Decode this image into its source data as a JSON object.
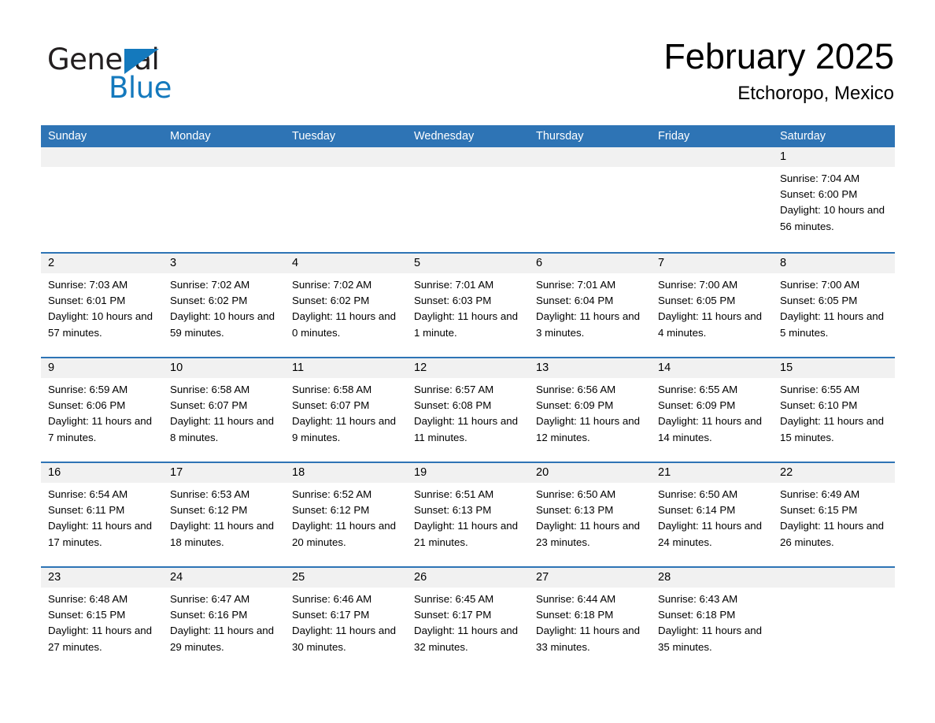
{
  "brand": {
    "name_part1": "General",
    "name_part2": "Blue"
  },
  "header": {
    "month_title": "February 2025",
    "location": "Etchoropo, Mexico"
  },
  "colors": {
    "header_blue": "#2e74b5",
    "logo_blue": "#1479bd",
    "day_band_gray": "#f1f1f1",
    "text": "#000000"
  },
  "weekdays": [
    "Sunday",
    "Monday",
    "Tuesday",
    "Wednesday",
    "Thursday",
    "Friday",
    "Saturday"
  ],
  "weeks": [
    [
      {
        "day": "",
        "sunrise": "",
        "sunset": "",
        "daylight": "",
        "empty": true
      },
      {
        "day": "",
        "sunrise": "",
        "sunset": "",
        "daylight": "",
        "empty": true
      },
      {
        "day": "",
        "sunrise": "",
        "sunset": "",
        "daylight": "",
        "empty": true
      },
      {
        "day": "",
        "sunrise": "",
        "sunset": "",
        "daylight": "",
        "empty": true
      },
      {
        "day": "",
        "sunrise": "",
        "sunset": "",
        "daylight": "",
        "empty": true
      },
      {
        "day": "",
        "sunrise": "",
        "sunset": "",
        "daylight": "",
        "empty": true
      },
      {
        "day": "1",
        "sunrise": "Sunrise: 7:04 AM",
        "sunset": "Sunset: 6:00 PM",
        "daylight": "Daylight: 10 hours and 56 minutes.",
        "empty": false
      }
    ],
    [
      {
        "day": "2",
        "sunrise": "Sunrise: 7:03 AM",
        "sunset": "Sunset: 6:01 PM",
        "daylight": "Daylight: 10 hours and 57 minutes.",
        "empty": false
      },
      {
        "day": "3",
        "sunrise": "Sunrise: 7:02 AM",
        "sunset": "Sunset: 6:02 PM",
        "daylight": "Daylight: 10 hours and 59 minutes.",
        "empty": false
      },
      {
        "day": "4",
        "sunrise": "Sunrise: 7:02 AM",
        "sunset": "Sunset: 6:02 PM",
        "daylight": "Daylight: 11 hours and 0 minutes.",
        "empty": false
      },
      {
        "day": "5",
        "sunrise": "Sunrise: 7:01 AM",
        "sunset": "Sunset: 6:03 PM",
        "daylight": "Daylight: 11 hours and 1 minute.",
        "empty": false
      },
      {
        "day": "6",
        "sunrise": "Sunrise: 7:01 AM",
        "sunset": "Sunset: 6:04 PM",
        "daylight": "Daylight: 11 hours and 3 minutes.",
        "empty": false
      },
      {
        "day": "7",
        "sunrise": "Sunrise: 7:00 AM",
        "sunset": "Sunset: 6:05 PM",
        "daylight": "Daylight: 11 hours and 4 minutes.",
        "empty": false
      },
      {
        "day": "8",
        "sunrise": "Sunrise: 7:00 AM",
        "sunset": "Sunset: 6:05 PM",
        "daylight": "Daylight: 11 hours and 5 minutes.",
        "empty": false
      }
    ],
    [
      {
        "day": "9",
        "sunrise": "Sunrise: 6:59 AM",
        "sunset": "Sunset: 6:06 PM",
        "daylight": "Daylight: 11 hours and 7 minutes.",
        "empty": false
      },
      {
        "day": "10",
        "sunrise": "Sunrise: 6:58 AM",
        "sunset": "Sunset: 6:07 PM",
        "daylight": "Daylight: 11 hours and 8 minutes.",
        "empty": false
      },
      {
        "day": "11",
        "sunrise": "Sunrise: 6:58 AM",
        "sunset": "Sunset: 6:07 PM",
        "daylight": "Daylight: 11 hours and 9 minutes.",
        "empty": false
      },
      {
        "day": "12",
        "sunrise": "Sunrise: 6:57 AM",
        "sunset": "Sunset: 6:08 PM",
        "daylight": "Daylight: 11 hours and 11 minutes.",
        "empty": false
      },
      {
        "day": "13",
        "sunrise": "Sunrise: 6:56 AM",
        "sunset": "Sunset: 6:09 PM",
        "daylight": "Daylight: 11 hours and 12 minutes.",
        "empty": false
      },
      {
        "day": "14",
        "sunrise": "Sunrise: 6:55 AM",
        "sunset": "Sunset: 6:09 PM",
        "daylight": "Daylight: 11 hours and 14 minutes.",
        "empty": false
      },
      {
        "day": "15",
        "sunrise": "Sunrise: 6:55 AM",
        "sunset": "Sunset: 6:10 PM",
        "daylight": "Daylight: 11 hours and 15 minutes.",
        "empty": false
      }
    ],
    [
      {
        "day": "16",
        "sunrise": "Sunrise: 6:54 AM",
        "sunset": "Sunset: 6:11 PM",
        "daylight": "Daylight: 11 hours and 17 minutes.",
        "empty": false
      },
      {
        "day": "17",
        "sunrise": "Sunrise: 6:53 AM",
        "sunset": "Sunset: 6:12 PM",
        "daylight": "Daylight: 11 hours and 18 minutes.",
        "empty": false
      },
      {
        "day": "18",
        "sunrise": "Sunrise: 6:52 AM",
        "sunset": "Sunset: 6:12 PM",
        "daylight": "Daylight: 11 hours and 20 minutes.",
        "empty": false
      },
      {
        "day": "19",
        "sunrise": "Sunrise: 6:51 AM",
        "sunset": "Sunset: 6:13 PM",
        "daylight": "Daylight: 11 hours and 21 minutes.",
        "empty": false
      },
      {
        "day": "20",
        "sunrise": "Sunrise: 6:50 AM",
        "sunset": "Sunset: 6:13 PM",
        "daylight": "Daylight: 11 hours and 23 minutes.",
        "empty": false
      },
      {
        "day": "21",
        "sunrise": "Sunrise: 6:50 AM",
        "sunset": "Sunset: 6:14 PM",
        "daylight": "Daylight: 11 hours and 24 minutes.",
        "empty": false
      },
      {
        "day": "22",
        "sunrise": "Sunrise: 6:49 AM",
        "sunset": "Sunset: 6:15 PM",
        "daylight": "Daylight: 11 hours and 26 minutes.",
        "empty": false
      }
    ],
    [
      {
        "day": "23",
        "sunrise": "Sunrise: 6:48 AM",
        "sunset": "Sunset: 6:15 PM",
        "daylight": "Daylight: 11 hours and 27 minutes.",
        "empty": false
      },
      {
        "day": "24",
        "sunrise": "Sunrise: 6:47 AM",
        "sunset": "Sunset: 6:16 PM",
        "daylight": "Daylight: 11 hours and 29 minutes.",
        "empty": false
      },
      {
        "day": "25",
        "sunrise": "Sunrise: 6:46 AM",
        "sunset": "Sunset: 6:17 PM",
        "daylight": "Daylight: 11 hours and 30 minutes.",
        "empty": false
      },
      {
        "day": "26",
        "sunrise": "Sunrise: 6:45 AM",
        "sunset": "Sunset: 6:17 PM",
        "daylight": "Daylight: 11 hours and 32 minutes.",
        "empty": false
      },
      {
        "day": "27",
        "sunrise": "Sunrise: 6:44 AM",
        "sunset": "Sunset: 6:18 PM",
        "daylight": "Daylight: 11 hours and 33 minutes.",
        "empty": false
      },
      {
        "day": "28",
        "sunrise": "Sunrise: 6:43 AM",
        "sunset": "Sunset: 6:18 PM",
        "daylight": "Daylight: 11 hours and 35 minutes.",
        "empty": false
      },
      {
        "day": "",
        "sunrise": "",
        "sunset": "",
        "daylight": "",
        "empty": true
      }
    ]
  ]
}
